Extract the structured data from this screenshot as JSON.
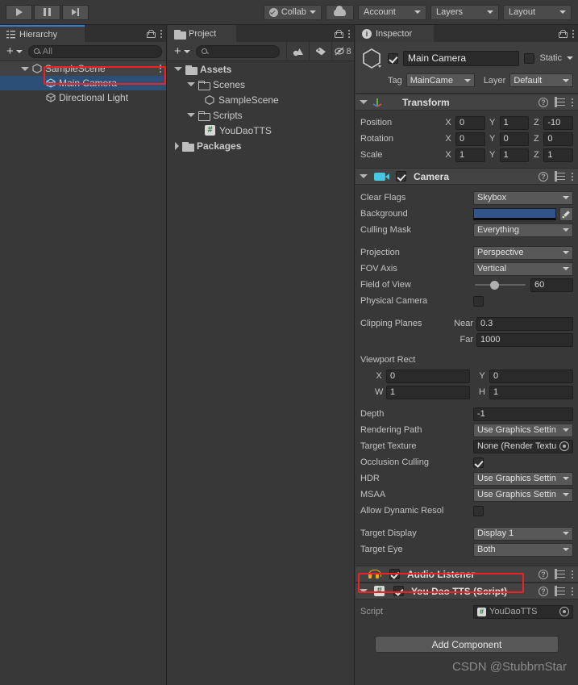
{
  "toolbar": {
    "play_label": "play-icon",
    "pause_label": "pause-icon",
    "step_label": "step-icon",
    "collab": "Collab",
    "cloud": "cloud-icon",
    "account": "Account",
    "layers": "Layers",
    "layout": "Layout"
  },
  "hierarchy": {
    "tab": "Hierarchy",
    "create_label": "+",
    "search_placeholder": "All",
    "search_value": "",
    "items": [
      {
        "label": "SampleScene",
        "indent": 1,
        "icon": "unity-scene-icon",
        "expanded": true,
        "selected": false
      },
      {
        "label": "Main Camera",
        "indent": 2,
        "icon": "gameobject-icon",
        "expanded": false,
        "selected": true
      },
      {
        "label": "Directional Light",
        "indent": 2,
        "icon": "gameobject-icon",
        "expanded": false,
        "selected": false
      }
    ]
  },
  "project": {
    "tab": "Project",
    "create_label": "+",
    "search_placeholder": "",
    "hidden_count": "8",
    "items": [
      {
        "label": "Assets",
        "indent": 0,
        "icon": "folder-icon",
        "expanded": true,
        "bold": true
      },
      {
        "label": "Scenes",
        "indent": 1,
        "icon": "folder-icon",
        "expanded": true,
        "bold": false
      },
      {
        "label": "SampleScene",
        "indent": 2,
        "icon": "unity-scene-icon",
        "expanded": null,
        "bold": false
      },
      {
        "label": "Scripts",
        "indent": 1,
        "icon": "folder-icon",
        "expanded": true,
        "bold": false
      },
      {
        "label": "YouDaoTTS",
        "indent": 2,
        "icon": "csharp-script-icon",
        "expanded": null,
        "bold": false
      },
      {
        "label": "Packages",
        "indent": 0,
        "icon": "folder-icon",
        "expanded": false,
        "bold": true
      }
    ]
  },
  "inspector": {
    "tab": "Inspector",
    "object_name": "Main Camera",
    "object_enabled": true,
    "static_label": "Static",
    "static_checked": false,
    "tag_label": "Tag",
    "tag_value": "MainCame",
    "layer_label": "Layer",
    "layer_value": "Default",
    "transform": {
      "title": "Transform",
      "position_label": "Position",
      "rotation_label": "Rotation",
      "scale_label": "Scale",
      "position": {
        "x": "0",
        "y": "1",
        "z": "-10"
      },
      "rotation": {
        "x": "0",
        "y": "0",
        "z": "0"
      },
      "scale": {
        "x": "1",
        "y": "1",
        "z": "1"
      }
    },
    "camera": {
      "title": "Camera",
      "enabled": true,
      "clear_flags_label": "Clear Flags",
      "clear_flags_value": "Skybox",
      "background_label": "Background",
      "background_color": "#33548a",
      "culling_mask_label": "Culling Mask",
      "culling_mask_value": "Everything",
      "projection_label": "Projection",
      "projection_value": "Perspective",
      "fov_axis_label": "FOV Axis",
      "fov_axis_value": "Vertical",
      "field_of_view_label": "Field of View",
      "field_of_view_value": "60",
      "physical_camera_label": "Physical Camera",
      "physical_camera_checked": false,
      "clipping_planes_label": "Clipping Planes",
      "near_label": "Near",
      "near_value": "0.3",
      "far_label": "Far",
      "far_value": "1000",
      "viewport_rect_label": "Viewport Rect",
      "viewport": {
        "x": "0",
        "y": "0",
        "w": "1",
        "h": "1"
      },
      "depth_label": "Depth",
      "depth_value": "-1",
      "rendering_path_label": "Rendering Path",
      "rendering_path_value": "Use Graphics Settin",
      "target_texture_label": "Target Texture",
      "target_texture_value": "None (Render Textu",
      "occlusion_culling_label": "Occlusion Culling",
      "occlusion_culling_checked": true,
      "hdr_label": "HDR",
      "hdr_value": "Use Graphics Settin",
      "msaa_label": "MSAA",
      "msaa_value": "Use Graphics Settin",
      "allow_dynamic_label": "Allow Dynamic Resol",
      "allow_dynamic_checked": false,
      "target_display_label": "Target Display",
      "target_display_value": "Display 1",
      "target_eye_label": "Target Eye",
      "target_eye_value": "Both"
    },
    "audio_listener": {
      "title": "Audio Listener",
      "enabled": true
    },
    "script_component": {
      "title": "You Dao TTS (Script)",
      "enabled": true,
      "script_label": "Script",
      "script_value": "YouDaoTTS"
    },
    "add_component": "Add Component"
  },
  "watermark": "CSDN @StubbrnStar",
  "colors": {
    "accent_blue": "#2b4f76",
    "highlight_red": "#ee2222",
    "tab_active": "#3d7bd1"
  }
}
